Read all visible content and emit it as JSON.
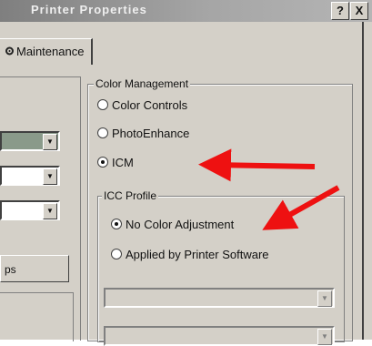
{
  "window": {
    "title": "Printer Properties",
    "help_label": "?",
    "close_label": "X"
  },
  "tabs": [
    {
      "label": "Maintenance",
      "icon": "gear-icon"
    }
  ],
  "left_panel": {
    "button_label": "ps"
  },
  "color_management": {
    "legend": "Color Management",
    "options": [
      {
        "label": "Color Controls",
        "checked": false
      },
      {
        "label": "PhotoEnhance",
        "checked": false
      },
      {
        "label": "ICM",
        "checked": true
      }
    ]
  },
  "icc_profile": {
    "legend": "ICC Profile",
    "options": [
      {
        "label": "No Color Adjustment",
        "checked": true
      },
      {
        "label": "Applied by Printer Software",
        "checked": false
      }
    ]
  },
  "colors": {
    "annotation_arrow": "#ee1111",
    "dialog_face": "#d4d0c8",
    "selected_combo": "#8a9a8a"
  }
}
